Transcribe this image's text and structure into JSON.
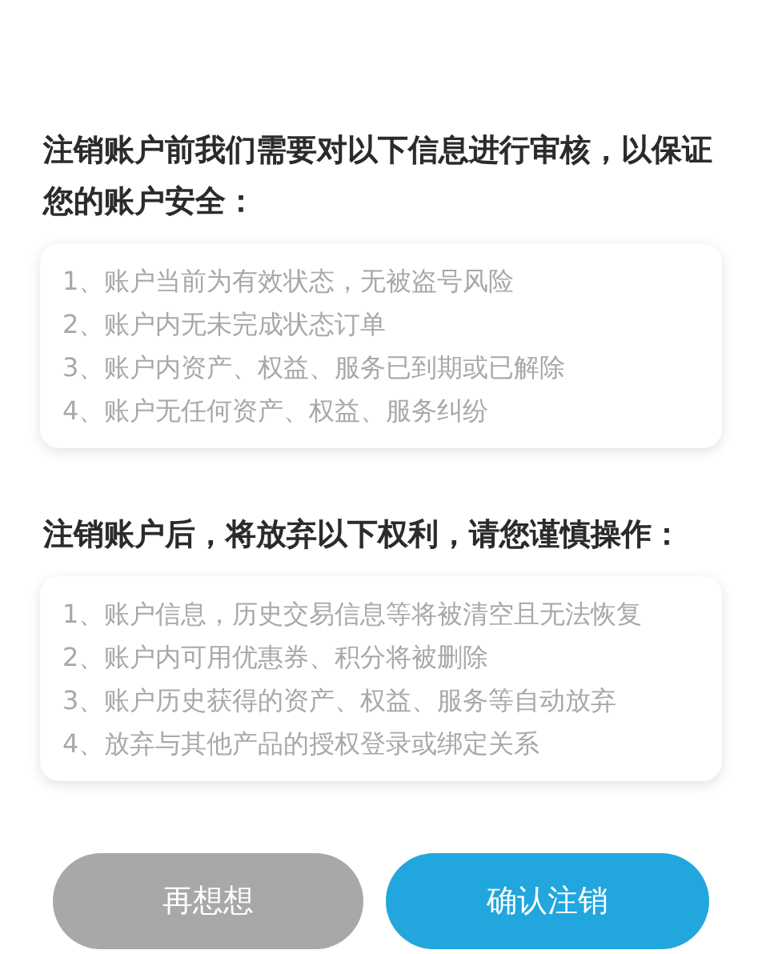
{
  "sections": [
    {
      "heading": "注销账户前我们需要对以下信息进行审核，以保证您的账户安全：",
      "items": [
        "1、账户当前为有效状态，无被盗号风险",
        "2、账户内无未完成状态订单",
        "3、账户内资产、权益、服务已到期或已解除",
        "4、账户无任何资产、权益、服务纠纷"
      ]
    },
    {
      "heading": "注销账户后，将放弃以下权利，请您谨慎操作：",
      "items": [
        "1、账户信息，历史交易信息等将被清空且无法恢复",
        "2、账户内可用优惠券、积分将被删除",
        "3、账户历史获得的资产、权益、服务等自动放弃",
        "4、放弃与其他产品的授权登录或绑定关系"
      ]
    }
  ],
  "buttons": [
    {
      "label": "再想想",
      "kind": "secondary"
    },
    {
      "label": "确认注销",
      "kind": "primary"
    }
  ]
}
